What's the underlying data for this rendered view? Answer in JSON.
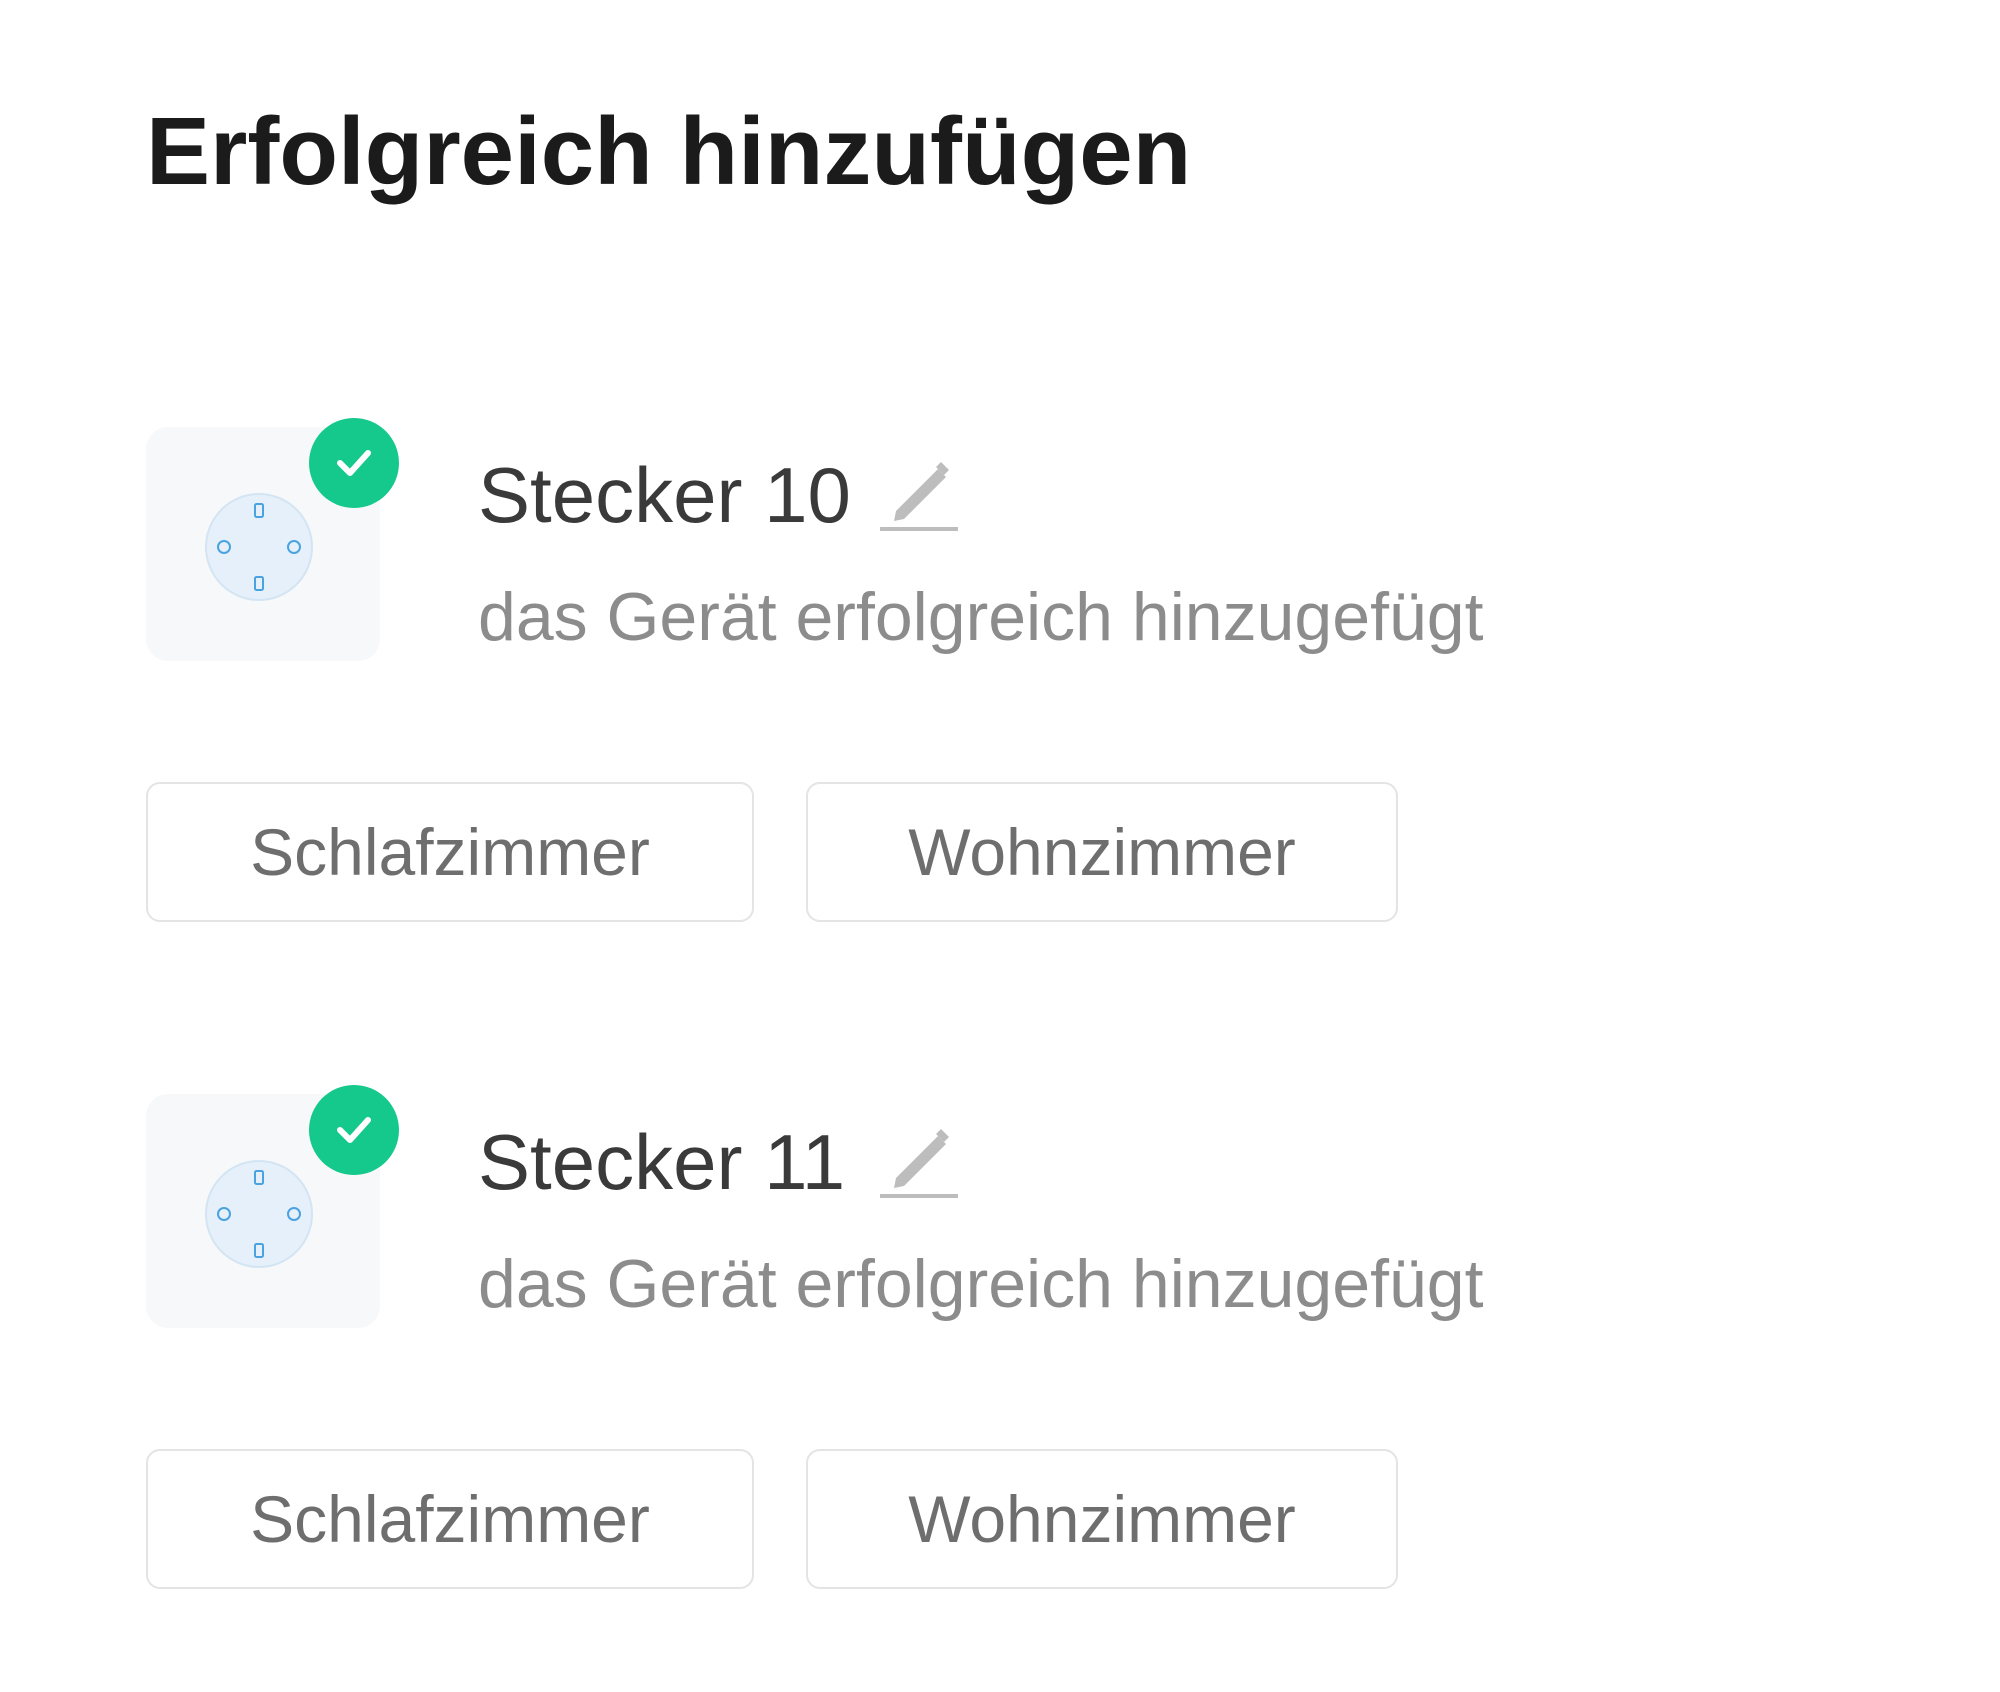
{
  "header": {
    "title": "Erfolgreich hinzufügen"
  },
  "devices": [
    {
      "name": "Stecker 10",
      "status": "das Gerät erfolgreich hinzugefügt",
      "icon": "smart-plug-icon",
      "rooms": [
        "Schlafzimmer",
        "Wohnzimmer"
      ]
    },
    {
      "name": "Stecker 11",
      "status": "das Gerät erfolgreich hinzugefügt",
      "icon": "smart-plug-icon",
      "rooms": [
        "Schlafzimmer",
        "Wohnzimmer"
      ]
    }
  ],
  "colors": {
    "success": "#15c98c",
    "title": "#1b1b1b",
    "name": "#3a3a3a",
    "status": "#8c8c8c",
    "button_text": "#6e6e6e",
    "button_border": "#e4e4e4",
    "plug_fill": "#e6f0fa",
    "plug_stroke": "#4aa3e0"
  }
}
